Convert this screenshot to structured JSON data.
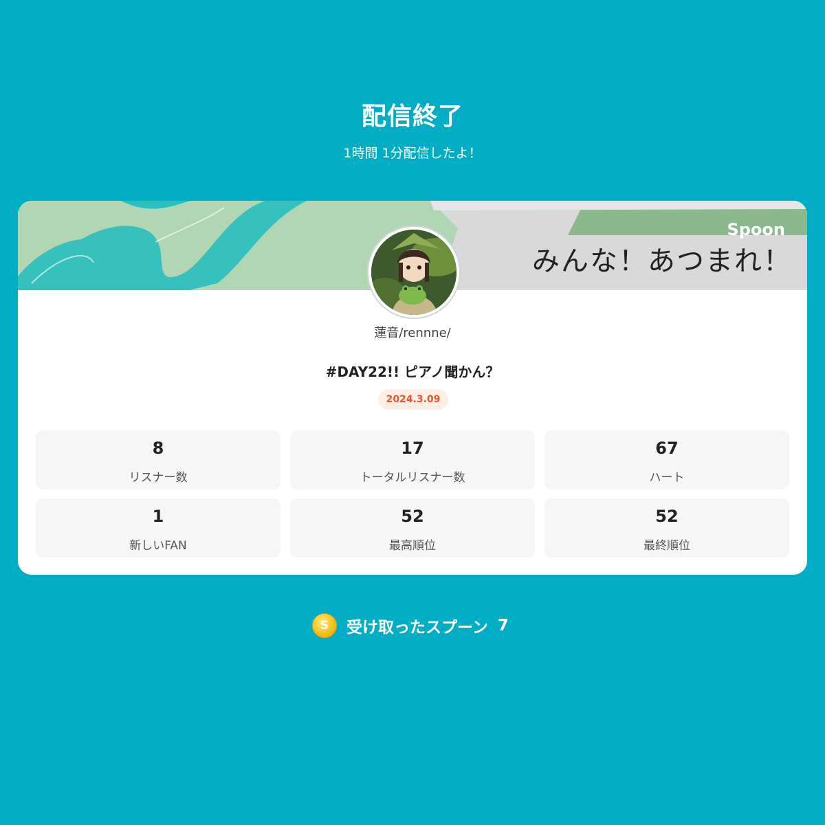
{
  "header": {
    "title": "配信終了",
    "duration_text": "1時間 1分配信したよ！"
  },
  "banner": {
    "text": "みんな！あつまれ！",
    "logo": "Spoon"
  },
  "profile": {
    "username": "蓮音/rennne/",
    "avatar": "avatar-image"
  },
  "stream": {
    "title": "#DAY22!! ピアノ聞かん？",
    "date": "2024.3.09"
  },
  "stats": [
    {
      "value": "8",
      "label": "リスナー数"
    },
    {
      "value": "17",
      "label": "トータルリスナー数"
    },
    {
      "value": "67",
      "label": "ハート"
    },
    {
      "value": "1",
      "label": "新しいFAN"
    },
    {
      "value": "52",
      "label": "最高順位"
    },
    {
      "value": "52",
      "label": "最終順位"
    }
  ],
  "spoons": {
    "icon": "coin-icon",
    "coin_letter": "S",
    "label": "受け取ったスプーン",
    "count": "7"
  },
  "colors": {
    "background": "#01adc4",
    "date_badge_text": "#e8552a",
    "date_badge_bg": "#fdeee6",
    "banner_green": "#b0d6b4",
    "banner_teal": "#2bbfbd"
  }
}
